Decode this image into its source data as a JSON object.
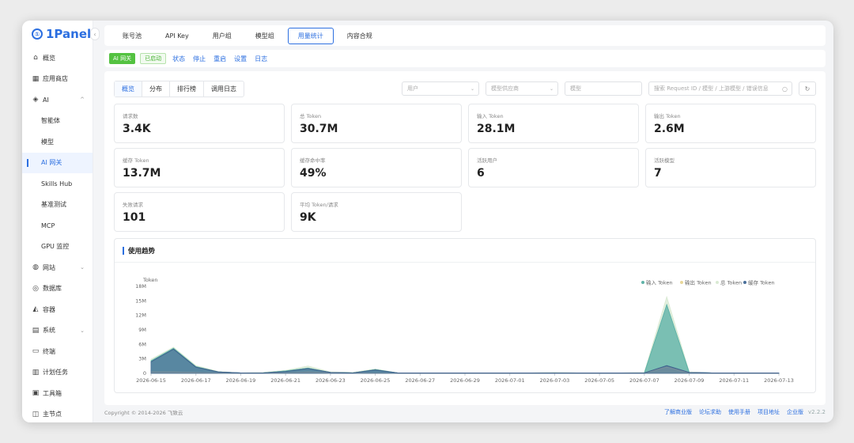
{
  "app": {
    "logo_text": "1Panel",
    "logo_mark": "①"
  },
  "sidebar": {
    "items": [
      {
        "label": "概览",
        "icon": "⌂",
        "icon_name": "home-icon"
      },
      {
        "label": "应用商店",
        "icon": "▦",
        "icon_name": "apps-icon"
      },
      {
        "label": "AI",
        "icon": "◈",
        "icon_name": "robot-icon",
        "chevron": "^"
      },
      {
        "label": "智能体",
        "sub": true
      },
      {
        "label": "模型",
        "sub": true
      },
      {
        "label": "AI 网关",
        "sub": true,
        "active": true
      },
      {
        "label": "Skills Hub",
        "sub": true
      },
      {
        "label": "基准测试",
        "sub": true
      },
      {
        "label": "MCP",
        "sub": true
      },
      {
        "label": "GPU 监控",
        "sub": true
      },
      {
        "label": "网站",
        "icon": "◍",
        "icon_name": "globe-icon",
        "chevron": "⌄"
      },
      {
        "label": "数据库",
        "icon": "◎",
        "icon_name": "database-icon"
      },
      {
        "label": "容器",
        "icon": "◭",
        "icon_name": "container-icon"
      },
      {
        "label": "系统",
        "icon": "▤",
        "icon_name": "system-icon",
        "chevron": "⌄"
      },
      {
        "label": "终端",
        "icon": "▭",
        "icon_name": "terminal-icon"
      },
      {
        "label": "计划任务",
        "icon": "▥",
        "icon_name": "cron-icon"
      },
      {
        "label": "工具箱",
        "icon": "▣",
        "icon_name": "toolbox-icon"
      },
      {
        "label": "主节点",
        "icon": "◫",
        "icon_name": "node-icon"
      }
    ]
  },
  "topbar": {
    "tabs": [
      "账号池",
      "API Key",
      "用户组",
      "模型组",
      "用量统计",
      "内容合规"
    ],
    "active": 4
  },
  "subbar": {
    "badge": "AI 网关",
    "status": "已启动",
    "links": [
      "状态",
      "停止",
      "重启",
      "设置",
      "日志"
    ]
  },
  "panel": {
    "tabs": [
      "概览",
      "分布",
      "排行榜",
      "调用日志"
    ],
    "active_tab": 0,
    "filters": {
      "user_placeholder": "用户",
      "provider_placeholder": "模型供应商",
      "model_placeholder": "模型",
      "search_placeholder": "搜索 Request ID / 模型 / 上游模型 / 错误信息",
      "search_icon": "○",
      "refresh_icon": "↻"
    },
    "cards": [
      {
        "label": "请求数",
        "value": "3.4K"
      },
      {
        "label": "总 Token",
        "value": "30.7M"
      },
      {
        "label": "输入 Token",
        "value": "28.1M"
      },
      {
        "label": "输出 Token",
        "value": "2.6M"
      },
      {
        "label": "缓存 Token",
        "value": "13.7M"
      },
      {
        "label": "缓存命中率",
        "value": "49%"
      },
      {
        "label": "活跃用户",
        "value": "6"
      },
      {
        "label": "活跃模型",
        "value": "7"
      },
      {
        "label": "失败请求",
        "value": "101"
      },
      {
        "label": "平均 Token/请求",
        "value": "9K"
      }
    ],
    "trend_title": "使用趋势"
  },
  "chart_data": {
    "type": "area",
    "ylabel": "Token",
    "yticks": [
      "0",
      "3M",
      "6M",
      "9M",
      "12M",
      "15M",
      "18M"
    ],
    "ylim": [
      0,
      18
    ],
    "y_unit": "M",
    "legend_placement": "top-right",
    "x": [
      "2026-06-15",
      "2026-06-16",
      "2026-06-17",
      "2026-06-18",
      "2026-06-19",
      "2026-06-20",
      "2026-06-21",
      "2026-06-22",
      "2026-06-23",
      "2026-06-24",
      "2026-06-25",
      "2026-06-26",
      "2026-06-27",
      "2026-06-28",
      "2026-06-29",
      "2026-06-30",
      "2026-07-01",
      "2026-07-02",
      "2026-07-03",
      "2026-07-04",
      "2026-07-05",
      "2026-07-06",
      "2026-07-07",
      "2026-07-08",
      "2026-07-09",
      "2026-07-10",
      "2026-07-11",
      "2026-07-12",
      "2026-07-13"
    ],
    "xticks": [
      "2026-06-15",
      "2026-06-17",
      "2026-06-19",
      "2026-06-21",
      "2026-06-23",
      "2026-06-25",
      "2026-06-27",
      "2026-06-29",
      "2026-07-01",
      "2026-07-03",
      "2026-07-05",
      "2026-07-07",
      "2026-07-09",
      "2026-07-11",
      "2026-07-13"
    ],
    "series": [
      {
        "name": "总 Token",
        "color": "#d9ead3",
        "values": [
          2.9,
          5.4,
          1.6,
          0.4,
          0.1,
          0.2,
          0.6,
          1.5,
          0.3,
          0.2,
          0.9,
          0.1,
          0.1,
          0.1,
          0.1,
          0.1,
          0.1,
          0.1,
          0.2,
          0.1,
          0.1,
          0.1,
          0.2,
          15.8,
          0.3,
          0.1,
          0.1,
          0.1,
          0.1
        ]
      },
      {
        "name": "输入 Token",
        "color": "#5fb3a8",
        "values": [
          2.6,
          5.2,
          1.4,
          0.3,
          0.1,
          0.1,
          0.5,
          1.1,
          0.2,
          0.1,
          0.8,
          0.1,
          0.1,
          0.1,
          0.1,
          0.1,
          0.1,
          0.1,
          0.1,
          0.1,
          0.1,
          0.1,
          0.1,
          14.2,
          0.2,
          0.1,
          0.1,
          0.1,
          0.1
        ]
      },
      {
        "name": "输出 Token",
        "color": "#e8d79a",
        "values": [
          0.3,
          0.3,
          0.2,
          0.1,
          0,
          0.1,
          0.1,
          0.3,
          0.1,
          0.1,
          0.1,
          0,
          0,
          0,
          0,
          0,
          0,
          0,
          0.1,
          0,
          0,
          0,
          0.1,
          1.3,
          0.1,
          0,
          0,
          0,
          0
        ]
      },
      {
        "name": "缓存 Token",
        "color": "#4a6f9a",
        "values": [
          2.4,
          5.0,
          1.3,
          0.3,
          0.1,
          0.1,
          0.4,
          1.0,
          0.2,
          0.1,
          0.7,
          0.1,
          0.1,
          0.1,
          0.1,
          0.1,
          0.1,
          0.1,
          0.1,
          0.1,
          0.1,
          0.1,
          0.1,
          1.6,
          0.2,
          0.1,
          0.1,
          0.1,
          0.1
        ]
      }
    ]
  },
  "footer": {
    "copyright": "Copyright © 2014-2026 飞致云",
    "links": [
      "了解商业版",
      "论坛求助",
      "使用手册",
      "项目地址",
      "企业版"
    ],
    "version": "v2.2.2"
  }
}
